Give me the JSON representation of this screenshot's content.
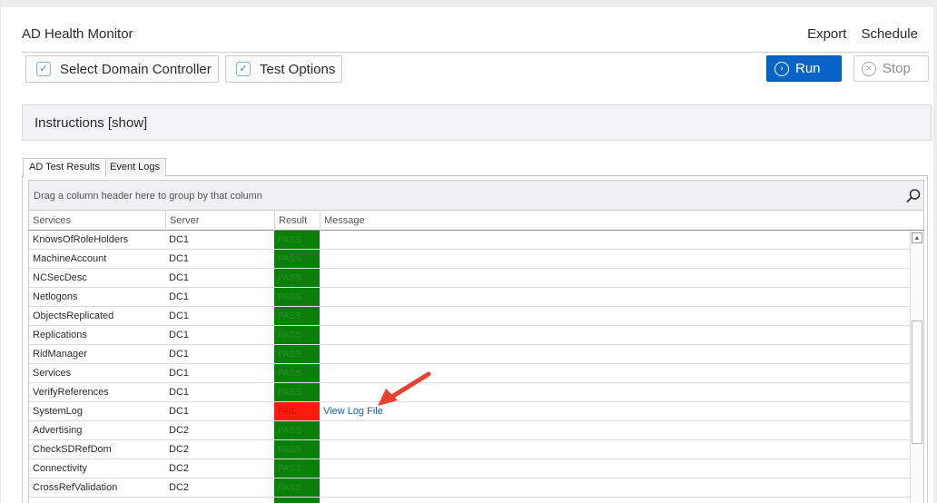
{
  "app": {
    "title": "AD Health Monitor"
  },
  "header": {
    "export_label": "Export",
    "schedule_label": "Schedule"
  },
  "toolbar": {
    "select_dc_label": "Select Domain Controller",
    "test_options_label": "Test Options",
    "run_label": "Run",
    "stop_label": "Stop"
  },
  "instructions": {
    "label": "Instructions [show]"
  },
  "tabs": [
    {
      "label": "AD Test Results",
      "active": true
    },
    {
      "label": "Event Logs",
      "active": false
    }
  ],
  "grid": {
    "group_hint": "Drag a column header here to group by that column",
    "columns": [
      "Services",
      "Server",
      "Result",
      "Message"
    ],
    "rows": [
      {
        "service": "KnowsOfRoleHolders",
        "server": "DC1",
        "result": "PASS",
        "message": ""
      },
      {
        "service": "MachineAccount",
        "server": "DC1",
        "result": "PASS",
        "message": ""
      },
      {
        "service": "NCSecDesc",
        "server": "DC1",
        "result": "PASS",
        "message": ""
      },
      {
        "service": "Netlogons",
        "server": "DC1",
        "result": "PASS",
        "message": ""
      },
      {
        "service": "ObjectsReplicated",
        "server": "DC1",
        "result": "PASS",
        "message": ""
      },
      {
        "service": "Replications",
        "server": "DC1",
        "result": "PASS",
        "message": ""
      },
      {
        "service": "RidManager",
        "server": "DC1",
        "result": "PASS",
        "message": ""
      },
      {
        "service": "Services",
        "server": "DC1",
        "result": "PASS",
        "message": ""
      },
      {
        "service": "VerifyReferences",
        "server": "DC1",
        "result": "PASS",
        "message": ""
      },
      {
        "service": "SystemLog",
        "server": "DC1",
        "result": "FAIL",
        "message": "View Log File"
      },
      {
        "service": "Advertising",
        "server": "DC2",
        "result": "PASS",
        "message": ""
      },
      {
        "service": "CheckSDRefDom",
        "server": "DC2",
        "result": "PASS",
        "message": ""
      },
      {
        "service": "Connectivity",
        "server": "DC2",
        "result": "PASS",
        "message": ""
      },
      {
        "service": "CrossRefValidation",
        "server": "DC2",
        "result": "PASS",
        "message": ""
      },
      {
        "service": "",
        "server": "",
        "result": "PASS",
        "message": ""
      }
    ]
  },
  "colors": {
    "pass": "#0a7f0a",
    "fail": "#ff1a0e",
    "run_button": "#0a64c8",
    "link": "#1a5fb4",
    "annotation_arrow": "#e8412f"
  },
  "icons": {
    "checkbox": "checkbox-checked-icon",
    "run": "play-circle-icon",
    "stop": "stop-circle-icon",
    "search": "search-icon",
    "scroll_up": "chevron-up-icon",
    "annotation": "arrow-annotation-icon"
  }
}
